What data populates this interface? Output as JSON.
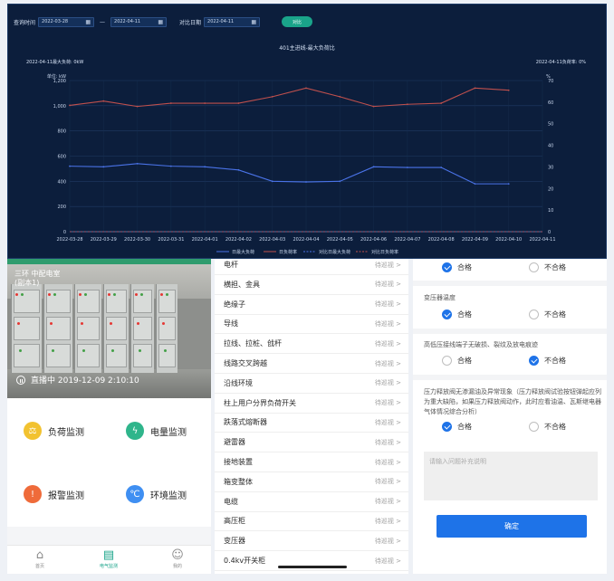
{
  "query": {
    "label_time": "查询时间",
    "start_date": "2022-03-28",
    "dash": "—",
    "end_date": "2022-04-11",
    "label_compare": "对比日期",
    "compare_date": "2022-04-11",
    "compare_btn": "对比"
  },
  "colors": {
    "red_series": "#c0504d",
    "blue_series": "#4a73e8",
    "teal": "#1aa48a",
    "primary": "#1e73e8"
  },
  "chart_data": {
    "type": "line",
    "title": "401主进线-最大负荷比",
    "corner_left": "2022-04-11最大负荷: 0kW",
    "corner_right": "2022-04-11负荷率: 0%",
    "ylabel_left": "单位: kW",
    "ylabel_right": "%",
    "ylim_left": [
      0,
      1200
    ],
    "ylim_right": [
      0,
      70
    ],
    "yticks_left": [
      "0",
      "200",
      "400",
      "600",
      "800",
      "1,000",
      "1,200"
    ],
    "yticks_right": [
      "0",
      "10",
      "20",
      "30",
      "40",
      "50",
      "60",
      "70"
    ],
    "categories": [
      "2022-03-28",
      "2022-03-29",
      "2022-03-30",
      "2022-03-31",
      "2022-04-01",
      "2022-04-02",
      "2022-04-03",
      "2022-04-04",
      "2022-04-05",
      "2022-04-06",
      "2022-04-07",
      "2022-04-08",
      "2022-04-09",
      "2022-04-10",
      "2022-04-11"
    ],
    "legend": [
      "日最大负荷",
      "日负荷率",
      "对比日最大负荷",
      "对比日负荷率"
    ],
    "series": [
      {
        "name": "日最大负荷",
        "axis": "left",
        "color": "#4a73e8",
        "values": [
          520,
          515,
          540,
          520,
          515,
          490,
          400,
          395,
          400,
          515,
          510,
          510,
          380,
          380,
          null
        ]
      },
      {
        "name": "日负荷率",
        "axis": "right",
        "color": "#c0504d",
        "values": [
          58.5,
          60.5,
          58,
          59.5,
          59.5,
          59.5,
          62.5,
          66.5,
          62.5,
          58,
          59,
          59.5,
          66.5,
          65.5,
          null
        ]
      },
      {
        "name": "对比日最大负荷",
        "axis": "left",
        "color": "#4a73e8",
        "values": [
          0,
          0,
          0,
          0,
          0,
          0,
          0,
          0,
          0,
          0,
          0,
          0,
          0,
          0,
          0
        ]
      },
      {
        "name": "对比日负荷率",
        "axis": "right",
        "color": "#c0504d",
        "values": [
          0,
          0,
          0,
          0,
          0,
          0,
          0,
          0,
          0,
          0,
          0,
          0,
          0,
          0,
          0
        ]
      }
    ]
  },
  "camera": {
    "caption": "三环 中配电室",
    "caption2": "(副本1)",
    "timestamp": "直播中 2019-12-09 2:10:10"
  },
  "monitors": [
    {
      "label": "负荷监测",
      "icon": "load-icon",
      "color": "#f2c230"
    },
    {
      "label": "电量监测",
      "icon": "power-icon",
      "color": "#2fb58b"
    },
    {
      "label": "报警监测",
      "icon": "alarm-icon",
      "color": "#ef6b3a"
    },
    {
      "label": "环境监测",
      "icon": "environment-icon",
      "color": "#3f8ff2"
    }
  ],
  "tabbar": [
    {
      "label": "首页",
      "icon": "home-icon"
    },
    {
      "label": "电气监测",
      "icon": "monitor-icon"
    },
    {
      "label": "我的",
      "icon": "user-icon"
    }
  ],
  "inspection_items": [
    {
      "name": "电杆",
      "status": "待巡视 >"
    },
    {
      "name": "横担、金具",
      "status": "待巡视 >"
    },
    {
      "name": "绝缘子",
      "status": "待巡视 >"
    },
    {
      "name": "导线",
      "status": "待巡视 >"
    },
    {
      "name": "拉线、拉桩、戗杆",
      "status": "待巡视 >"
    },
    {
      "name": "线路交叉跨越",
      "status": "待巡视 >"
    },
    {
      "name": "沿线环境",
      "status": "待巡视 >"
    },
    {
      "name": "柱上用户分界负荷开关",
      "status": "待巡视 >"
    },
    {
      "name": "跌落式熔断器",
      "status": "待巡视 >"
    },
    {
      "name": "避雷器",
      "status": "待巡视 >"
    },
    {
      "name": "接地装置",
      "status": "待巡视 >"
    },
    {
      "name": "箱变整体",
      "status": "待巡视 >"
    },
    {
      "name": "电缆",
      "status": "待巡视 >"
    },
    {
      "name": "高压柜",
      "status": "待巡视 >"
    },
    {
      "name": "变压器",
      "status": "待巡视 >"
    },
    {
      "name": "0.4kv开关柜",
      "status": "待巡视 >"
    }
  ],
  "checklist": {
    "pass": "合格",
    "fail": "不合格",
    "q1": "变压器温度",
    "q2": "高低压接线端子无破损、裂纹及放电痕迹",
    "q3": "压力释放阀无渗漏油及异常现象（压力释放阀试验按钮弹起应列为重大缺陷，如果压力释放阀动作，此时应看油温、瓦斯继电器气体情况综合分析）",
    "note_placeholder": "请输入问题补充说明",
    "confirm": "确定"
  }
}
